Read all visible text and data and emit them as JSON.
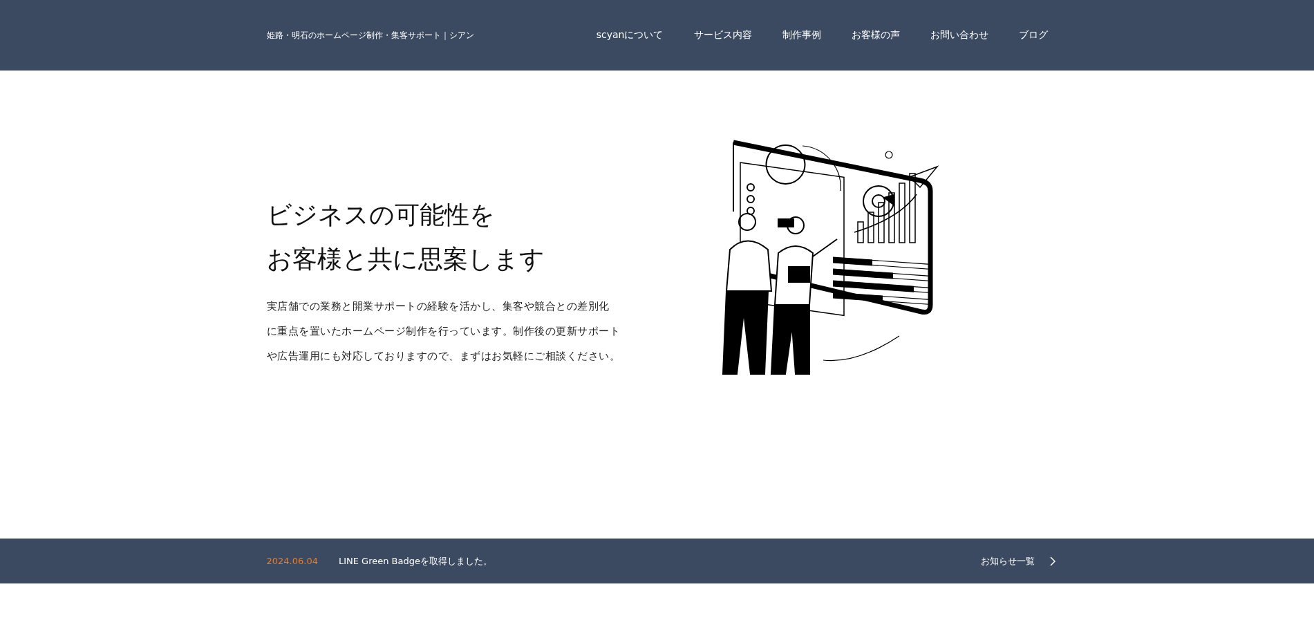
{
  "header": {
    "site_title": "姫路・明石のホームページ制作・集客サポート｜シアン",
    "nav": [
      {
        "label": "scyanについて"
      },
      {
        "label": "サービス内容"
      },
      {
        "label": "制作事例"
      },
      {
        "label": "お客様の声"
      },
      {
        "label": "お問い合わせ"
      },
      {
        "label": "ブログ"
      }
    ]
  },
  "hero": {
    "heading_lines": [
      "ビジネスの可能性を",
      "お客様と共に思案します"
    ],
    "description_lines": [
      "実店舗での業務と開業サポートの経験を活かし、集客や競合との差別化",
      "に重点を置いたホームページ制作を行っています。制作後の更新サポート",
      "や広告運用にも対応しておりますので、まずはお気軽にご相談ください。"
    ]
  },
  "news": {
    "date": "2024.06.04",
    "title": "LINE Green Badgeを取得しました。",
    "more_link": "お知らせ一覧"
  }
}
